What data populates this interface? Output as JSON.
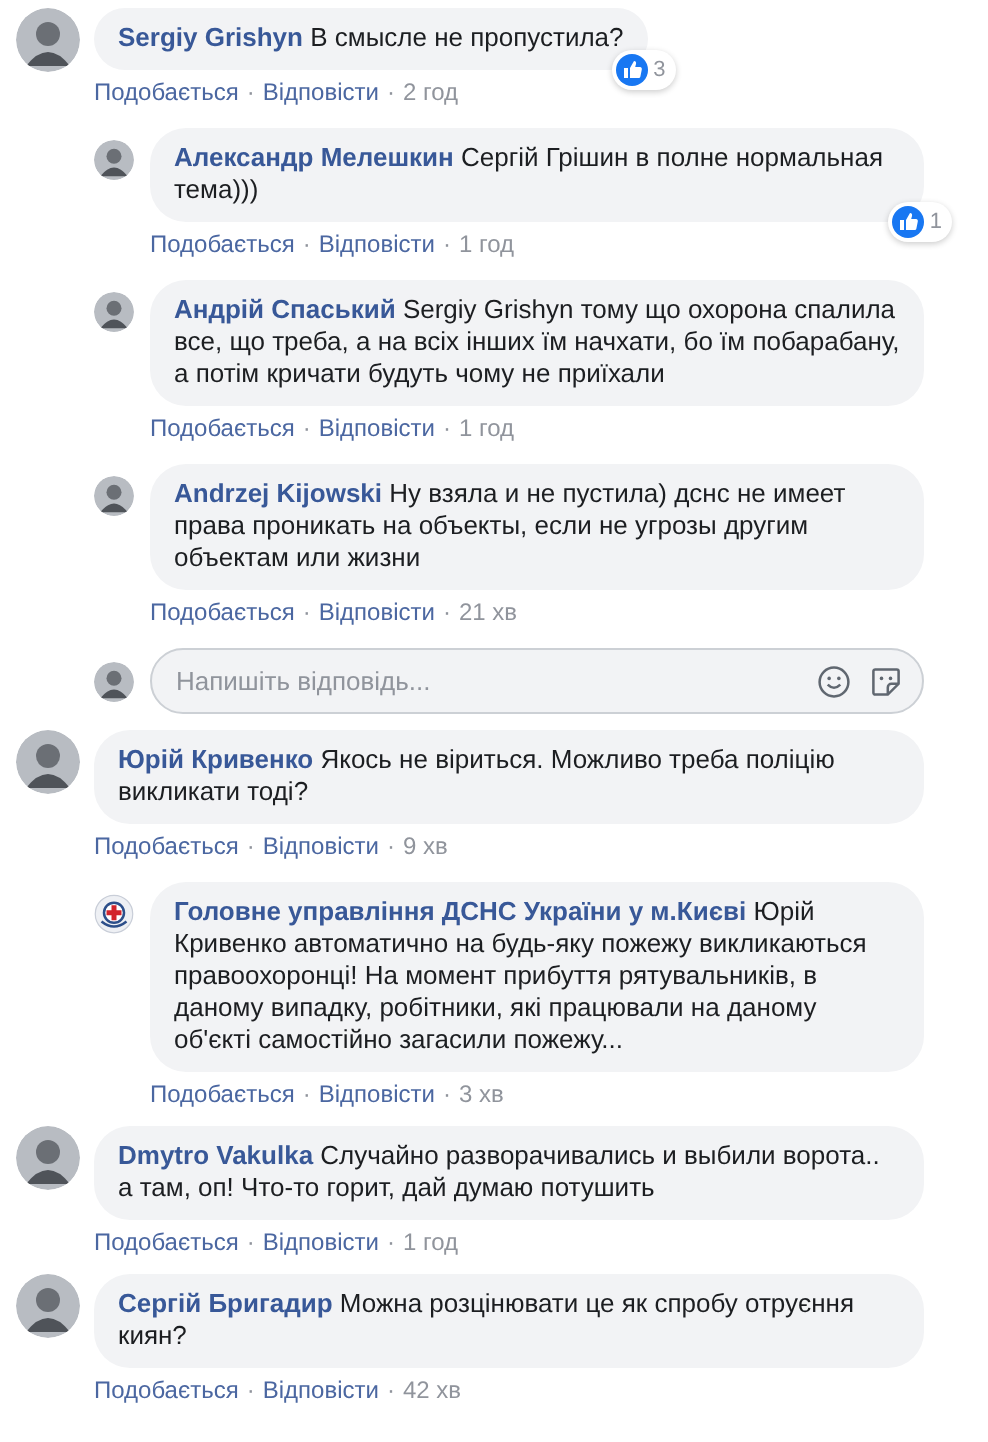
{
  "separator": "·",
  "comments": [
    {
      "author": "Sergiy Grishyn",
      "text": "В смысле не пропустила?",
      "avatar": {
        "kind": "photo"
      },
      "reactions": "3",
      "like": "Подобається",
      "reply": "Відповісти",
      "time": "2 год",
      "children": [
        {
          "author": "Александр Мелешкин",
          "text": "Сергій Грішин в полне нормальная тема)))",
          "avatar": {
            "kind": "photo"
          },
          "reactions": "1",
          "like": "Подобається",
          "reply": "Відповісти",
          "time": "1 год"
        },
        {
          "author": "Андрій Спаський",
          "text": "Sergiy Grishyn тому що охорона спалила все, що треба, а на всіх інших їм начхати, бо їм побарабану, а потім кричати будуть чому не приїхали",
          "avatar": {
            "kind": "photo"
          },
          "like": "Подобається",
          "reply": "Відповісти",
          "time": "1 год"
        },
        {
          "author": "Andrzej Kijowski",
          "text": "Ну взяла и не пустила) дснс не имеет права проникать на объекты, если не угрозы другим объектам или жизни",
          "avatar": {
            "kind": "photo"
          },
          "like": "Подобається",
          "reply": "Відповісти",
          "time": "21 хв"
        }
      ],
      "reply_box": {
        "placeholder": "Напишіть відповідь..."
      }
    },
    {
      "author": "Юрій Кривенко",
      "text": "Якось не віриться. Можливо треба поліцію викликати тоді?",
      "avatar": {
        "kind": "photo"
      },
      "like": "Подобається",
      "reply": "Відповісти",
      "time": "9 хв",
      "children": [
        {
          "author": "Головне управління ДСНС України у м.Києві",
          "text": "Юрій Кривенко автоматично на будь-яку пожежу викликаються правоохоронці! На момент прибуття рятувальників, в даному випадку, робітники, які працювали на даному об'єкті самостійно загасили пожежу...",
          "avatar": {
            "kind": "logo"
          },
          "like": "Подобається",
          "reply": "Відповісти",
          "time": "3 хв"
        }
      ]
    },
    {
      "author": "Dmytro Vakulka",
      "text": "Случайно разворачивались и выбили ворота.. а там, оп! Что-то горит, дай думаю потушить",
      "avatar": {
        "kind": "photo"
      },
      "like": "Подобається",
      "reply": "Відповісти",
      "time": "1 год"
    },
    {
      "author": "Сергій Бригадир",
      "text": "Можна розцінювати це як спробу отруєння киян?",
      "avatar": {
        "kind": "photo"
      },
      "like": "Подобається",
      "reply": "Відповісти",
      "time": "42 хв"
    }
  ]
}
